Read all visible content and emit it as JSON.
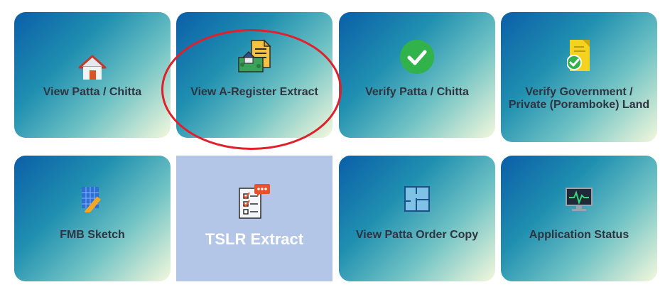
{
  "tiles": [
    {
      "label": "View Patta / Chitta",
      "icon": "house-icon"
    },
    {
      "label": "View A-Register Extract",
      "icon": "land-document-icon"
    },
    {
      "label": "Verify Patta / Chitta",
      "icon": "check-circle-icon"
    },
    {
      "label": "Verify Government / Private (Poramboke) Land",
      "icon": "verified-document-icon"
    },
    {
      "label": "FMB Sketch",
      "icon": "ruler-grid-icon"
    },
    {
      "label": "TSLR Extract",
      "icon": "checklist-icon"
    },
    {
      "label": "View Patta Order Copy",
      "icon": "floor-plan-icon"
    },
    {
      "label": "Application Status",
      "icon": "monitor-pulse-icon"
    }
  ],
  "colors": {
    "tile_gradient": [
      "#0b5ea8",
      "#1f8fb0",
      "#6fc2c4",
      "#f3f8dc"
    ],
    "selected_tile": "#b3c6e7",
    "highlight_ring": "#e0202a",
    "label_text": "#2e3440"
  }
}
